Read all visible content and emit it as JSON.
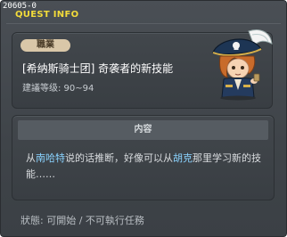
{
  "window": {
    "code": "20605-0",
    "title": "QUEST INFO"
  },
  "quest": {
    "job_badge": "職業",
    "name": "[希纳斯骑士团] 奇袭者的新技能",
    "level": "建議等级: 90~94"
  },
  "content": {
    "header": "内容",
    "text_1": "从",
    "npc_1": "南哈特",
    "text_2": "说的话推断，好像可以从",
    "npc_2": "胡克",
    "text_3": "那里学习新的技能……"
  },
  "status": "狀態: 可開始 / 不可執行任務",
  "colors": {
    "title": "#f3dc3a",
    "npc_highlight": "#8ad3ff",
    "badge": "#d9c7a8"
  }
}
